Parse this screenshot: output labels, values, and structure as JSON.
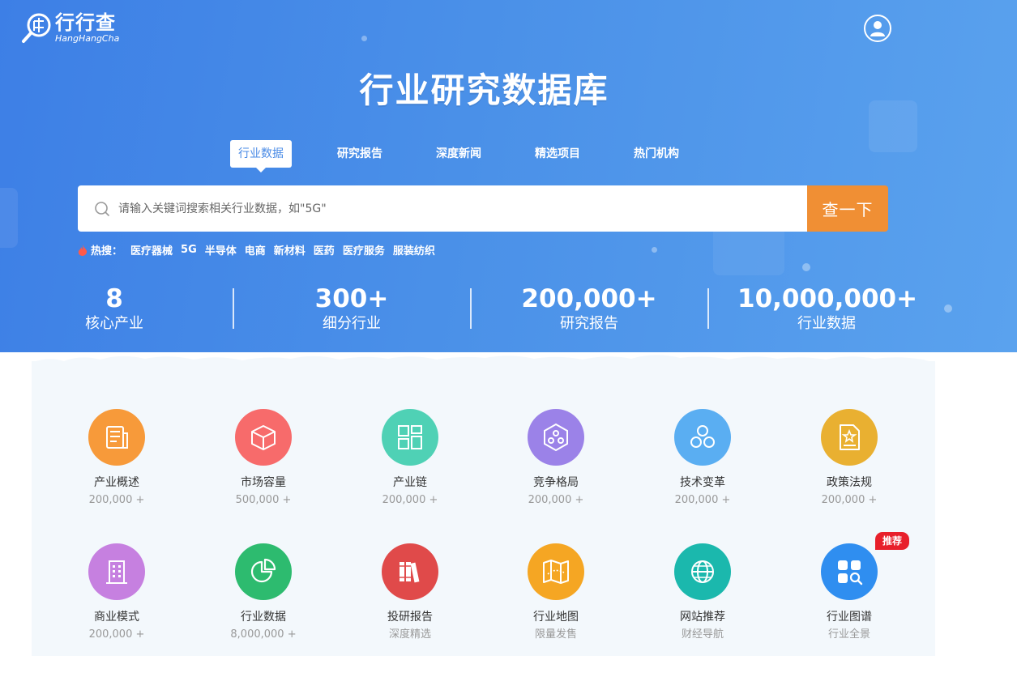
{
  "brand": {
    "name_cn": "行行查",
    "name_en": "HangHangCha"
  },
  "hero": {
    "title": "行业研究数据库"
  },
  "tabs": [
    {
      "label": "行业数据",
      "active": true
    },
    {
      "label": "研究报告",
      "active": false
    },
    {
      "label": "深度新闻",
      "active": false
    },
    {
      "label": "精选项目",
      "active": false
    },
    {
      "label": "热门机构",
      "active": false
    }
  ],
  "search": {
    "placeholder": "请输入关键词搜索相关行业数据，如\"5G\"",
    "value": "",
    "button_label": "查一下"
  },
  "hot": {
    "label": "热搜：",
    "items": [
      "医疗器械",
      "5G",
      "半导体",
      "电商",
      "新材料",
      "医药",
      "医疗服务",
      "服装纺织"
    ]
  },
  "stats": [
    {
      "value": "8",
      "label": "核心产业"
    },
    {
      "value": "300+",
      "label": "细分行业"
    },
    {
      "value": "200,000+",
      "label": "研究报告"
    },
    {
      "value": "10,000,000+",
      "label": "行业数据"
    }
  ],
  "categories": [
    {
      "name": "产业概述",
      "sub": "200,000 +",
      "icon": "document-list-icon",
      "color": "#f79a3a"
    },
    {
      "name": "市场容量",
      "sub": "500,000 +",
      "icon": "box-icon",
      "color": "#f76b6b"
    },
    {
      "name": "产业链",
      "sub": "200,000 +",
      "icon": "chain-blocks-icon",
      "color": "#4fd1b5"
    },
    {
      "name": "竞争格局",
      "sub": "200,000 +",
      "icon": "hexagon-network-icon",
      "color": "#9b82e8"
    },
    {
      "name": "技术变革",
      "sub": "200,000 +",
      "icon": "molecule-icon",
      "color": "#5aaef2"
    },
    {
      "name": "政策法规",
      "sub": "200,000 +",
      "icon": "policy-document-icon",
      "color": "#e9b031"
    },
    {
      "name": "商业模式",
      "sub": "200,000 +",
      "icon": "building-icon",
      "color": "#c680e0"
    },
    {
      "name": "行业数据",
      "sub": "8,000,000 +",
      "icon": "pie-chart-icon",
      "color": "#2dbb6f"
    },
    {
      "name": "投研报告",
      "sub": "深度精选",
      "icon": "books-icon",
      "color": "#e04a4a"
    },
    {
      "name": "行业地图",
      "sub": "限量发售",
      "icon": "map-icon",
      "color": "#f5a623"
    },
    {
      "name": "网站推荐",
      "sub": "财经导航",
      "icon": "globe-icon",
      "color": "#1bb8ad"
    },
    {
      "name": "行业图谱",
      "sub": "行业全景",
      "icon": "graph-search-icon",
      "color": "#2f8ef0",
      "badge": "推荐"
    }
  ]
}
